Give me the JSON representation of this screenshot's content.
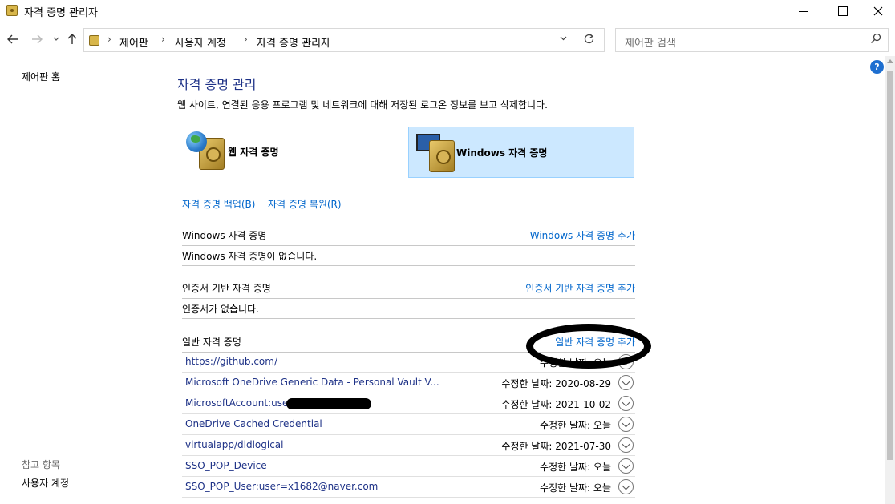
{
  "window": {
    "title": "자격 증명 관리자"
  },
  "navigation": {
    "breadcrumb": [
      "제어판",
      "사용자 계정",
      "자격 증명 관리자"
    ],
    "search_placeholder": "제어판 검색"
  },
  "left_pane": {
    "home_link": "제어판 홈",
    "see_also_title": "참고 항목",
    "user_accounts_link": "사용자 계정"
  },
  "main": {
    "title": "자격 증명 관리",
    "description": "웹 사이트, 연결된 응용 프로그램 및 네트워크에 대해 저장된 로그온 정보를 보고 삭제합니다.",
    "tiles": {
      "web": "웹 자격 증명",
      "windows": "Windows 자격 증명"
    },
    "backup_link": "자격 증명 백업(B)",
    "restore_link": "자격 증명 복원(R)",
    "sections": {
      "windows": {
        "title": "Windows 자격 증명",
        "add_link": "Windows 자격 증명 추가",
        "empty_text": "Windows 자격 증명이 없습니다."
      },
      "certificate": {
        "title": "인증서 기반 자격 증명",
        "add_link": "인증서 기반 자격 증명 추가",
        "empty_text": "인증서가 없습니다."
      },
      "generic": {
        "title": "일반 자격 증명",
        "add_link": "일반 자격 증명 추가",
        "rows": [
          {
            "name": "https://github.com/",
            "date": "수정한 날짜: 오늘"
          },
          {
            "name": "Microsoft OneDrive Generic Data - Personal Vault V...",
            "date": "수정한 날짜:  2020-08-29"
          },
          {
            "name": "MicrosoftAccount:user=",
            "date": "수정한 날짜:  2021-10-02"
          },
          {
            "name": "OneDrive Cached Credential",
            "date": "수정한 날짜:  오늘"
          },
          {
            "name": "virtualapp/didlogical",
            "date": "수정한 날짜:  2021-07-30"
          },
          {
            "name": "SSO_POP_Device",
            "date": "수정한 날짜:  오늘"
          },
          {
            "name": "SSO_POP_User:user=x1682@naver.com",
            "date": "수정한 날짜:  오늘"
          }
        ]
      }
    }
  },
  "colors": {
    "heading": "#1e3287",
    "link": "#0066cc",
    "selected_tile": "#cce8ff"
  }
}
